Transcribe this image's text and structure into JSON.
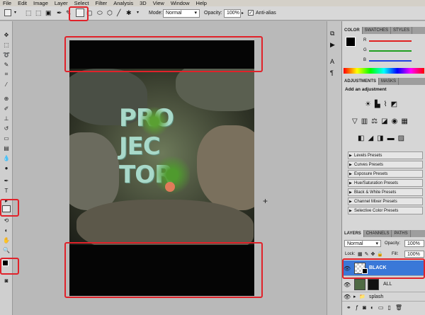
{
  "menu": [
    "File",
    "Edit",
    "Image",
    "Layer",
    "Select",
    "Filter",
    "Analysis",
    "3D",
    "View",
    "Window",
    "Help"
  ],
  "options": {
    "mode_label": "Mode:",
    "mode_value": "Normal",
    "opacity_label": "Opacity:",
    "opacity_value": "100%",
    "antialias_label": "Anti-alias"
  },
  "color_panel": {
    "tabs": [
      "COLOR",
      "SWATCHES",
      "STYLES"
    ],
    "channels": [
      "R",
      "G",
      "B"
    ],
    "channel_colors": [
      "#e02020",
      "#20a020",
      "#2040e0"
    ]
  },
  "adjustments_panel": {
    "tabs": [
      "ADJUSTMENTS",
      "MASKS"
    ],
    "heading": "Add an adjustment",
    "presets": [
      "Levels Presets",
      "Curves Presets",
      "Exposure Presets",
      "Hue/Saturation Presets",
      "Black & White Presets",
      "Channel Mixer Presets",
      "Selective Color Presets"
    ]
  },
  "layers_panel": {
    "tabs": [
      "LAYERS",
      "CHANNELS",
      "PATHS"
    ],
    "blend_mode": "Normal",
    "opacity_label": "Opacity:",
    "opacity_value": "100%",
    "lock_label": "Lock:",
    "fill_label": "Fill:",
    "fill_value": "100%",
    "layers": [
      {
        "name": "BLACK",
        "selected": true
      },
      {
        "name": "ALL",
        "selected": false
      },
      {
        "name": "splash",
        "selected": false
      }
    ]
  },
  "artwork": {
    "lines": [
      "PRO",
      "JEC",
      "TOR"
    ]
  },
  "colors": {
    "accent_highlight": "#e0222a",
    "layer_selected": "#3a78d8",
    "foreground": "#000000",
    "background": "#ffffff"
  }
}
